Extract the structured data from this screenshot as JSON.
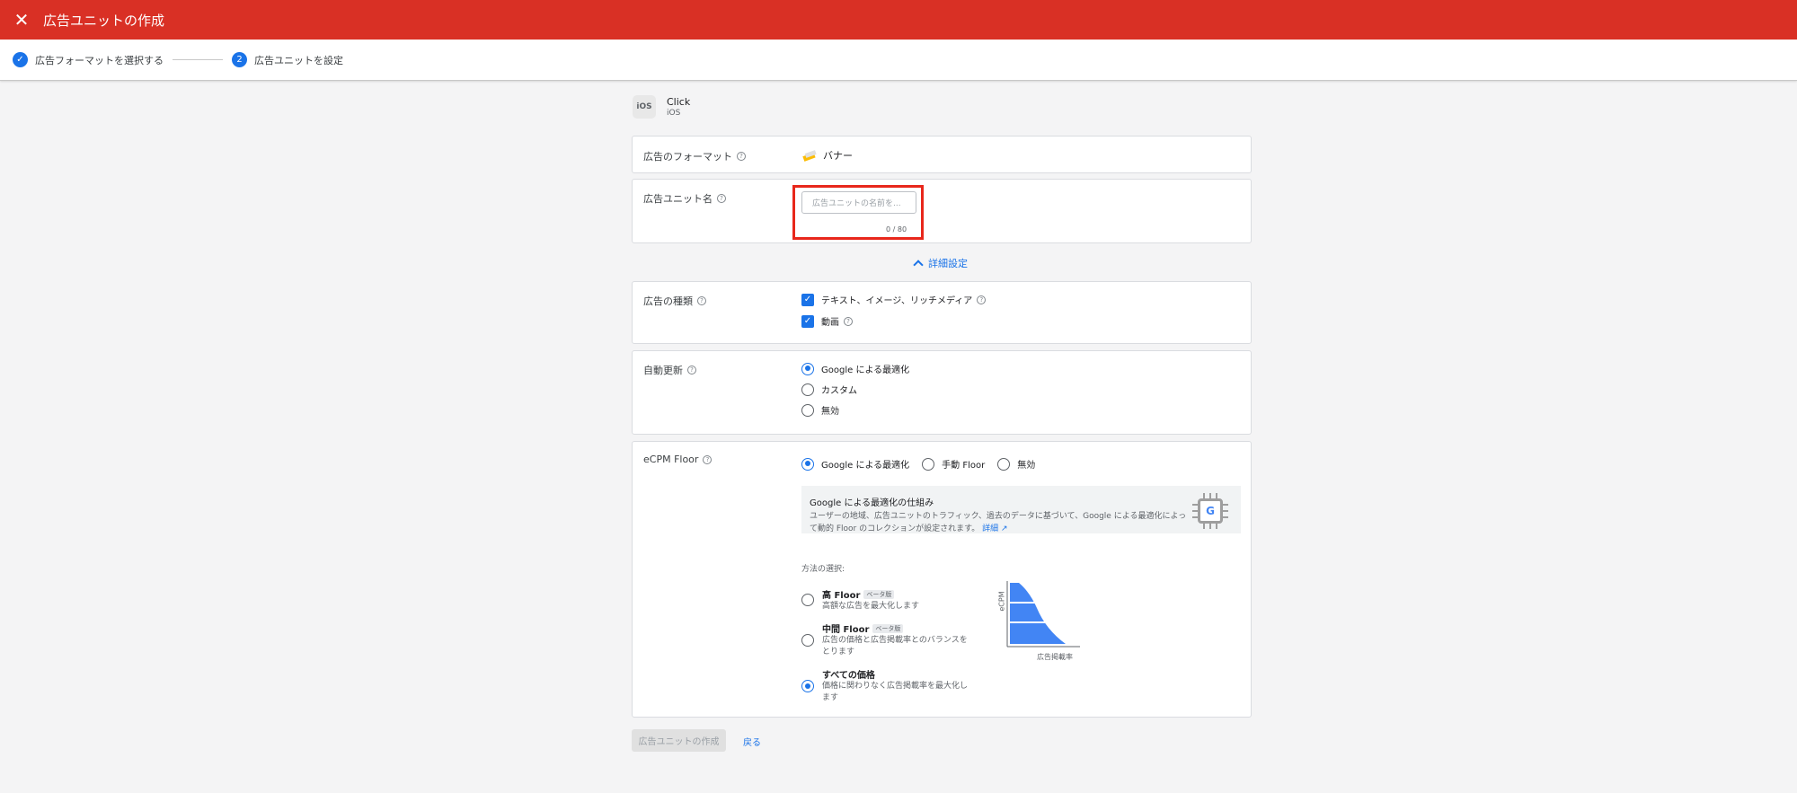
{
  "header": {
    "title": "広告ユニットの作成",
    "close_icon": "close-icon"
  },
  "stepper": {
    "step1": "広告フォーマットを選択する",
    "step2_number": "2",
    "step2": "広告ユニットを設定"
  },
  "app": {
    "icon_text": "iOS",
    "name": "Click",
    "platform": "iOS"
  },
  "format": {
    "label": "広告のフォーマット",
    "value": "バナー"
  },
  "unit_name": {
    "label": "広告ユニット名",
    "placeholder": "広告ユニットの名前を...",
    "value": "",
    "counter": "0 / 80"
  },
  "advanced": {
    "label": "詳細設定"
  },
  "ad_types": {
    "label": "広告の種類",
    "options": [
      "テキスト、イメージ、リッチメディア",
      "動画"
    ],
    "checked": [
      true,
      true
    ]
  },
  "auto_refresh": {
    "label": "自動更新",
    "options": [
      "Google による最適化",
      "カスタム",
      "無効"
    ],
    "selected": 0
  },
  "ecpm": {
    "label": "eCPM Floor",
    "options": [
      "Google による最適化",
      "手動 Floor",
      "無効"
    ],
    "selected": 0,
    "info_title": "Google による最適化の仕組み",
    "info_text": "ユーザーの地域、広告ユニットのトラフィック、過去のデータに基づいて、Google による最適化によって動的 Floor のコレクションが設定されます。",
    "info_link": "詳細",
    "method_label": "方法の選択:",
    "methods": [
      {
        "title": "高 Floor",
        "badge": "ベータ版",
        "desc": "高額な広告を最大化します"
      },
      {
        "title": "中間 Floor",
        "badge": "ベータ版",
        "desc": "広告の価格と広告掲載率とのバランスをとります"
      },
      {
        "title": "すべての価格",
        "badge": "",
        "desc": "価格に関わりなく広告掲載率を最大化します"
      }
    ],
    "method_selected": 2,
    "graph_ylabel": "eCPM",
    "graph_xlabel": "広告掲載率"
  },
  "footer": {
    "create_label": "広告ユニットの作成",
    "back_label": "戻る"
  },
  "colors": {
    "header": "#d93025",
    "accent": "#1a73e8",
    "highlight": "#e8271b"
  }
}
